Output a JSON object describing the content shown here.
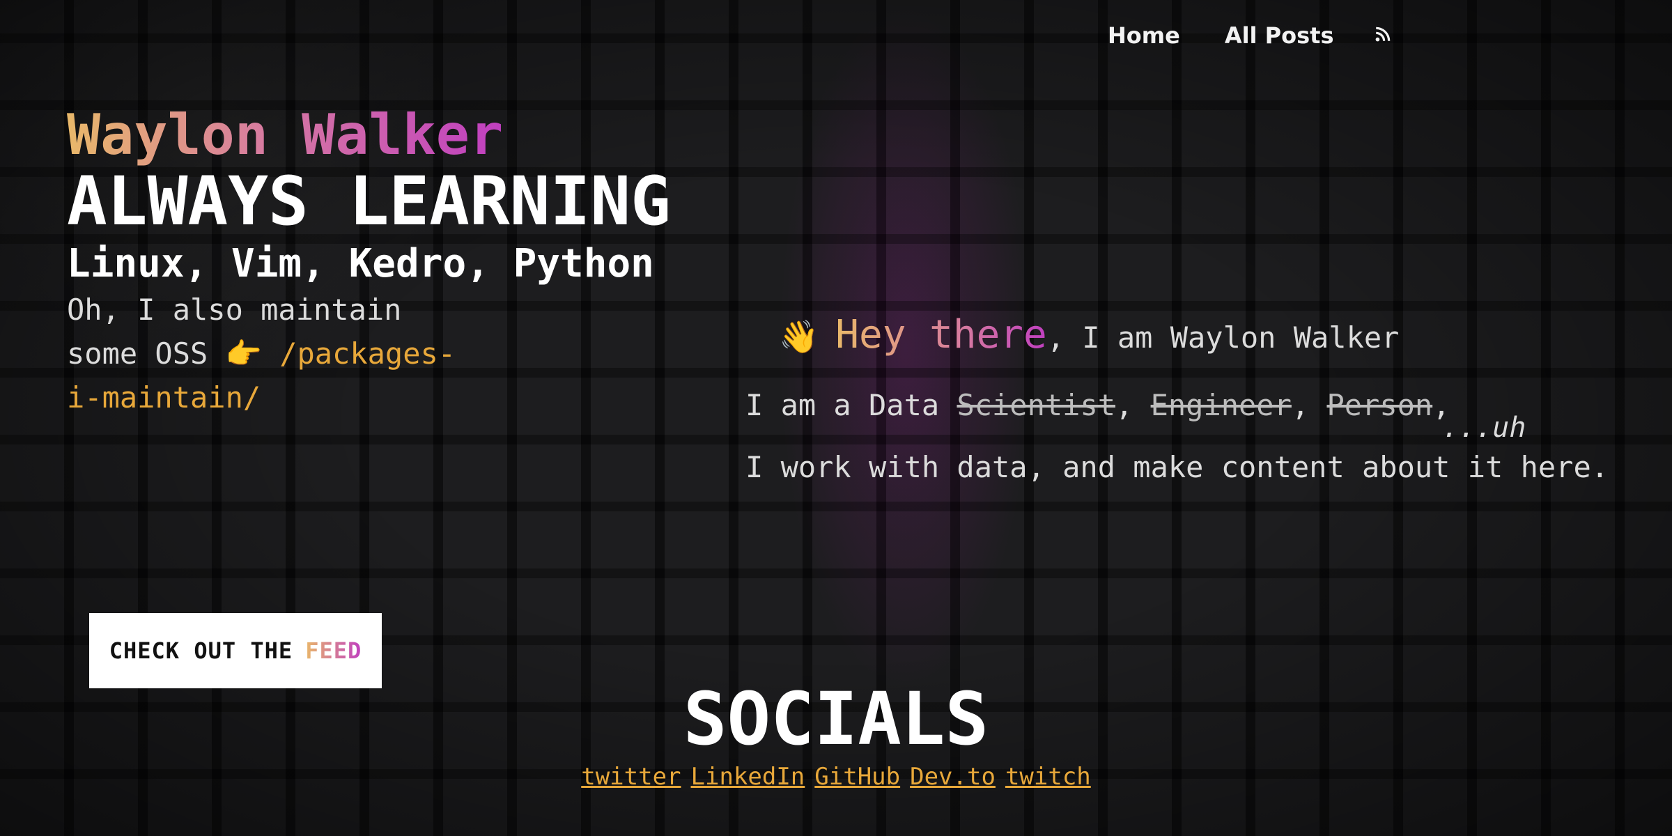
{
  "nav": {
    "home": "Home",
    "all_posts": "All Posts",
    "rss_icon": "rss-icon"
  },
  "hero": {
    "brand": "Waylon Walker",
    "tagline": "ALWAYS LEARNING",
    "skills": "Linux, Vim, Kedro, Python",
    "oss_text": "Oh, I also maintain some OSS",
    "oss_emoji": "👉",
    "oss_link": "/packages-i-maintain/"
  },
  "feed_button": {
    "prefix": "CHECK OUT THE",
    "word": "FEED"
  },
  "intro": {
    "wave": "👋",
    "hey": "Hey there",
    "name_line": ", I am Waylon Walker",
    "role_prefix": "I am a Data ",
    "role_scientist": "Scientist",
    "role_engineer": "Engineer",
    "role_person": "Person",
    "role_uh": "...uh",
    "work_line": "I work with data, and make content about it here."
  },
  "socials": {
    "title": "SOCIALS",
    "links": [
      "twitter",
      "LinkedIn",
      "GitHub",
      "Dev.to",
      "twitch"
    ]
  },
  "colors": {
    "accent_gold": "#e8a83a",
    "accent_pink": "#c03fc0",
    "background": "#111113"
  }
}
